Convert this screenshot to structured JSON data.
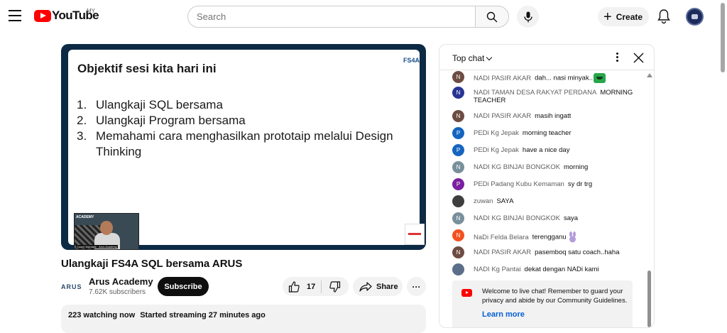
{
  "header": {
    "logo_text": "YouTube",
    "country": "MY",
    "search_placeholder": "Search",
    "create_label": "Create"
  },
  "video": {
    "slide": {
      "title": "Objektif sesi kita hari ini",
      "badge": "FS4A",
      "items": [
        {
          "num": "1.",
          "text": "Ulangkaji SQL bersama"
        },
        {
          "num": "2.",
          "text": "Ulangkaji Program bersama"
        },
        {
          "num": "3.",
          "text": "Memahami cara menghasilkan prototaip melalui Design Thinking"
        }
      ],
      "presenter_top_label": "ACADEMY",
      "presenter_bottom_label": "Coach Nizmalis · Arus Academy"
    },
    "title": "Ulangkaji FS4A SQL bersama ARUS"
  },
  "channel": {
    "logo_text": "ARUS",
    "name": "Arus Academy",
    "subscribers": "7.62K subscribers",
    "subscribe_label": "Subscribe"
  },
  "actions": {
    "like_count": "17",
    "share_label": "Share",
    "more_label": "···"
  },
  "description": {
    "watching": "223 watching now",
    "started": "Started streaming 27 minutes ago"
  },
  "chat": {
    "mode_label": "Top chat",
    "messages": [
      {
        "initial": "N",
        "color": "#6d4c41",
        "author": "NADI PASIR AKAR",
        "text": "dah... nasi minyak.."
      },
      {
        "initial": "N",
        "color": "#283593",
        "author": "NADI TAMAN DESA RAKYAT PERDANA",
        "text": "MORNING TEACHER"
      },
      {
        "initial": "N",
        "color": "#6d4c41",
        "author": "NADI PASIR AKAR",
        "text": "masih ingatt"
      },
      {
        "initial": "P",
        "color": "#1565c0",
        "author": "PEDi Kg Jepak",
        "text": "morning teacher"
      },
      {
        "initial": "P",
        "color": "#1565c0",
        "author": "PEDi Kg Jepak",
        "text": "have a nice day"
      },
      {
        "initial": "N",
        "color": "#78909c",
        "author": "NADI KG BINJAI BONGKOK",
        "text": "morning"
      },
      {
        "initial": "P",
        "color": "#7b1fa2",
        "author": "PEDi Padang Kubu Kemaman",
        "text": "sy dr trg"
      },
      {
        "initial": "",
        "color": "#3e3e3e",
        "author": "zuwan",
        "text": "SAYA"
      },
      {
        "initial": "N",
        "color": "#78909c",
        "author": "NADI KG BINJAI BONGKOK",
        "text": "saya"
      },
      {
        "initial": "N",
        "color": "#f4511e",
        "author": "NaDi Felda Belara",
        "text": "terengganu"
      },
      {
        "initial": "N",
        "color": "#6d4c41",
        "author": "NADI PASIR AKAR",
        "text": "pasemboq satu coach..haha"
      },
      {
        "initial": "",
        "color": "#5c6f8a",
        "author": "NADI Kg Pantai",
        "text": "dekat dengan NADi kami"
      }
    ],
    "welcome_text": "Welcome to live chat! Remember to guard your privacy and abide by our Community Guidelines.",
    "learn_more": "Learn more"
  }
}
